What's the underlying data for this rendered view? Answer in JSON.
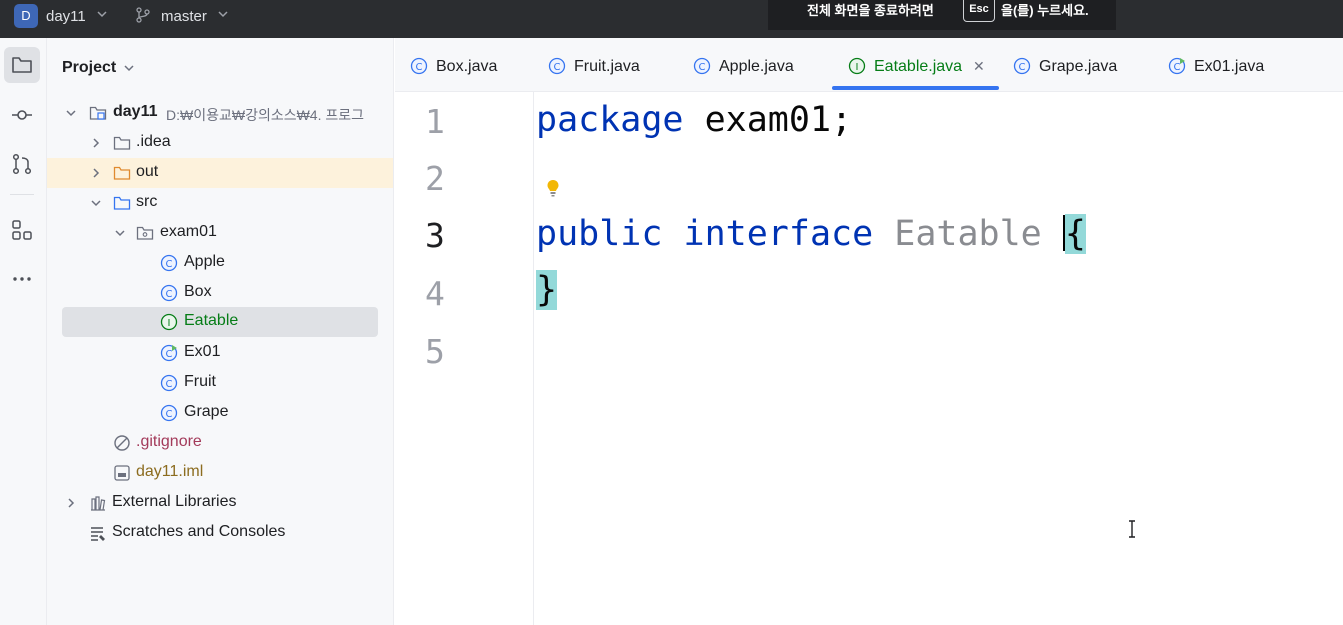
{
  "titlebar": {
    "project_initial": "D",
    "project_name": "day11",
    "branch": "master"
  },
  "fullscreen_banner": {
    "text_before": "전체 화면을 종료하려면",
    "key": "Esc",
    "text_after": "을(를) 누르세요."
  },
  "project_panel": {
    "title": "Project",
    "tree": {
      "root": {
        "label": "day11",
        "path": "D:₩이용교₩강의소스₩4. 프로그"
      },
      "idea": ".idea",
      "out": "out",
      "src": "src",
      "exam01": "exam01",
      "apple": "Apple",
      "box": "Box",
      "eatable": "Eatable",
      "ex01": "Ex01",
      "fruit": "Fruit",
      "grape": "Grape",
      "gitignore": ".gitignore",
      "iml": "day11.iml",
      "external_libraries": "External Libraries",
      "scratches": "Scratches and Consoles"
    }
  },
  "tabs": [
    {
      "label": "Box.java"
    },
    {
      "label": "Fruit.java"
    },
    {
      "label": "Apple.java"
    },
    {
      "label": "Eatable.java",
      "active": true
    },
    {
      "label": "Grape.java"
    },
    {
      "label": "Ex01.java"
    }
  ],
  "editor": {
    "line_numbers": [
      "1",
      "2",
      "3",
      "4",
      "5"
    ],
    "line1": {
      "keyword": "package",
      "rest": " exam01;"
    },
    "line3": {
      "kw1": "public",
      "kw2": "interface",
      "class_name": "Eatable",
      "brace": "{"
    },
    "line4": {
      "brace": "}"
    }
  },
  "colors": {
    "accent": "#3574f0",
    "keyword": "#0033b3",
    "brace_highlight": "#93d9d9",
    "interface_green": "#067d17",
    "git_ignored": "#a33a5a",
    "out_highlight": "#fdf2dc"
  }
}
